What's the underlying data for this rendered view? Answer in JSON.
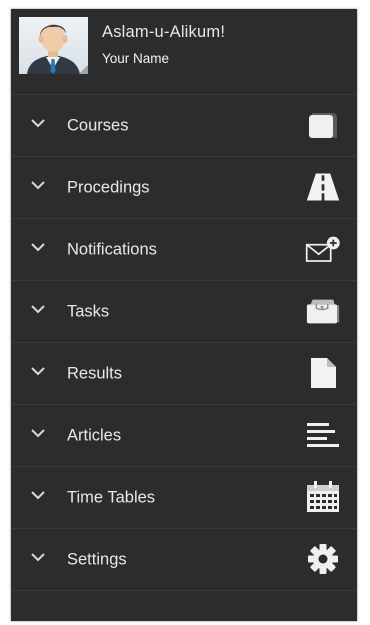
{
  "header": {
    "greeting": "Aslam-u-Alikum!",
    "user_name": "Your Name"
  },
  "menu": {
    "items": [
      {
        "label": "Courses",
        "icon": "square-icon"
      },
      {
        "label": "Procedings",
        "icon": "road-icon"
      },
      {
        "label": "Notifications",
        "icon": "mail-add-icon"
      },
      {
        "label": "Tasks",
        "icon": "wallet-icon"
      },
      {
        "label": "Results",
        "icon": "document-icon"
      },
      {
        "label": "Articles",
        "icon": "align-left-icon"
      },
      {
        "label": "Time Tables",
        "icon": "calendar-icon"
      },
      {
        "label": "Settings",
        "icon": "gear-icon"
      }
    ]
  },
  "colors": {
    "drawer_background": "#2c2c2c",
    "divider": "#3b3b3b",
    "text": "#e8e8e8"
  }
}
